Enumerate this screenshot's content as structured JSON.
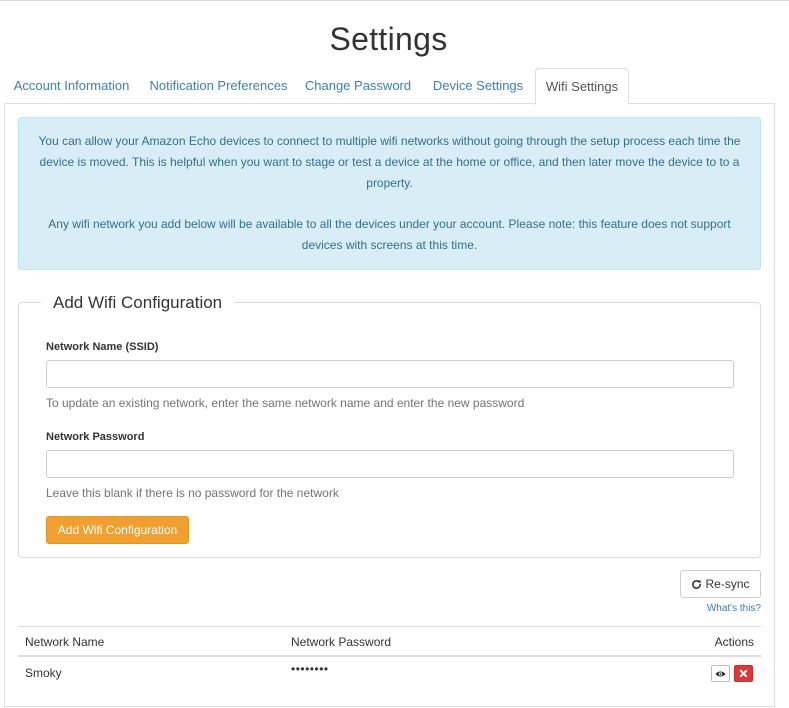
{
  "page": {
    "title": "Settings"
  },
  "tabs": [
    {
      "label": "Account Information",
      "active": false
    },
    {
      "label": "Notification Preferences",
      "active": false
    },
    {
      "label": "Change Password",
      "active": false
    },
    {
      "label": "Device Settings",
      "active": false
    },
    {
      "label": "Wifi Settings",
      "active": true
    }
  ],
  "info": {
    "paragraph1": "You can allow your Amazon Echo devices to connect to multiple wifi networks without going through the setup process each time the device is moved. This is helpful when you want to stage or test a device at the home or office, and then later move the device to to a property.",
    "paragraph2": "Any wifi network you add below will be available to all the devices under your account. Please note: this feature does not support devices with screens at this time."
  },
  "form": {
    "legend": "Add Wifi Configuration",
    "ssid_label": "Network Name (SSID)",
    "ssid_value": "",
    "ssid_help": "To update an existing network, enter the same network name and enter the new password",
    "password_label": "Network Password",
    "password_value": "",
    "password_help": "Leave this blank if there is no password for the network",
    "submit_label": "Add Wifi Configuration"
  },
  "resync": {
    "label": "Re-sync",
    "icon": "refresh-icon",
    "help_link": "What's this?"
  },
  "table": {
    "headers": [
      "Network Name",
      "Network Password",
      "Actions"
    ],
    "rows": [
      {
        "name": "Smoky",
        "password": "••••••••",
        "actions": [
          "eye-icon",
          "delete-icon"
        ]
      }
    ]
  },
  "colors": {
    "accent_link": "#3c7fb9",
    "primary_button": "#f0a030",
    "info_bg": "#d9edf7",
    "info_text": "#31708f",
    "danger": "#d9393a"
  }
}
